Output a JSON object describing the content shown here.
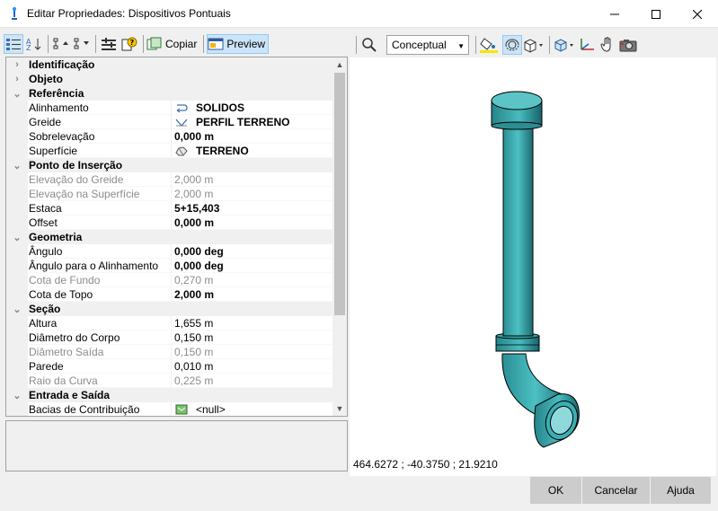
{
  "window": {
    "title": "Editar Propriedades: Dispositivos Pontuais",
    "minimize_icon": "minimize-icon",
    "maximize_icon": "maximize-icon",
    "close_icon": "close-icon"
  },
  "left_toolbar": {
    "copy_label": "Copiar",
    "preview_label": "Preview"
  },
  "grid": {
    "categories": [
      {
        "label": "Identificação",
        "expanded": false
      },
      {
        "label": "Objeto",
        "expanded": false
      },
      {
        "label": "Referência",
        "expanded": true,
        "props": [
          {
            "name": "Alinhamento",
            "value": "SOLIDOS",
            "bold": true,
            "icon": "alignment-icon"
          },
          {
            "name": "Greide",
            "value": "PERFIL TERRENO",
            "bold": true,
            "icon": "profile-icon"
          },
          {
            "name": "Sobrelevação",
            "value": "0,000 m",
            "bold": true
          },
          {
            "name": "Superfície",
            "value": "TERRENO",
            "bold": true,
            "icon": "surface-icon"
          }
        ]
      },
      {
        "label": "Ponto de Inserção",
        "expanded": true,
        "props": [
          {
            "name": "Elevação do Greide",
            "value": "2,000 m",
            "dim": true
          },
          {
            "name": "Elevação na Superfície",
            "value": "2,000 m",
            "dim": true
          },
          {
            "name": "Estaca",
            "value": "5+15,403",
            "bold": true
          },
          {
            "name": "Offset",
            "value": "0,000 m",
            "bold": true
          }
        ]
      },
      {
        "label": "Geometria",
        "expanded": true,
        "props": [
          {
            "name": "Ângulo",
            "value": "0,000 deg",
            "bold": true
          },
          {
            "name": "Ângulo para o Alinhamento",
            "value": "0,000 deg",
            "bold": true
          },
          {
            "name": "Cota de Fundo",
            "value": "0,270 m",
            "dim": true
          },
          {
            "name": "Cota de Topo",
            "value": "2,000 m",
            "bold": true
          }
        ]
      },
      {
        "label": "Seção",
        "expanded": true,
        "props": [
          {
            "name": "Altura",
            "value": "1,655 m"
          },
          {
            "name": "Diâmetro do Corpo",
            "value": "0,150 m"
          },
          {
            "name": "Diâmetro Saída",
            "value": "0,150 m",
            "dim": true
          },
          {
            "name": "Parede",
            "value": "0,010 m"
          },
          {
            "name": "Raio da Curva",
            "value": "0,225 m",
            "dim": true
          }
        ]
      },
      {
        "label": "Entrada e Saída",
        "expanded": true,
        "props": [
          {
            "name": "Bacias de Contribuição",
            "value": "<null>",
            "icon": "basin-icon"
          }
        ]
      }
    ]
  },
  "viewer": {
    "visual_style": "Conceptual",
    "coordinates": "464.6272 ; -40.3750 ; 21.9210"
  },
  "footer": {
    "ok_label": "OK",
    "cancel_label": "Cancelar",
    "help_label": "Ajuda"
  }
}
